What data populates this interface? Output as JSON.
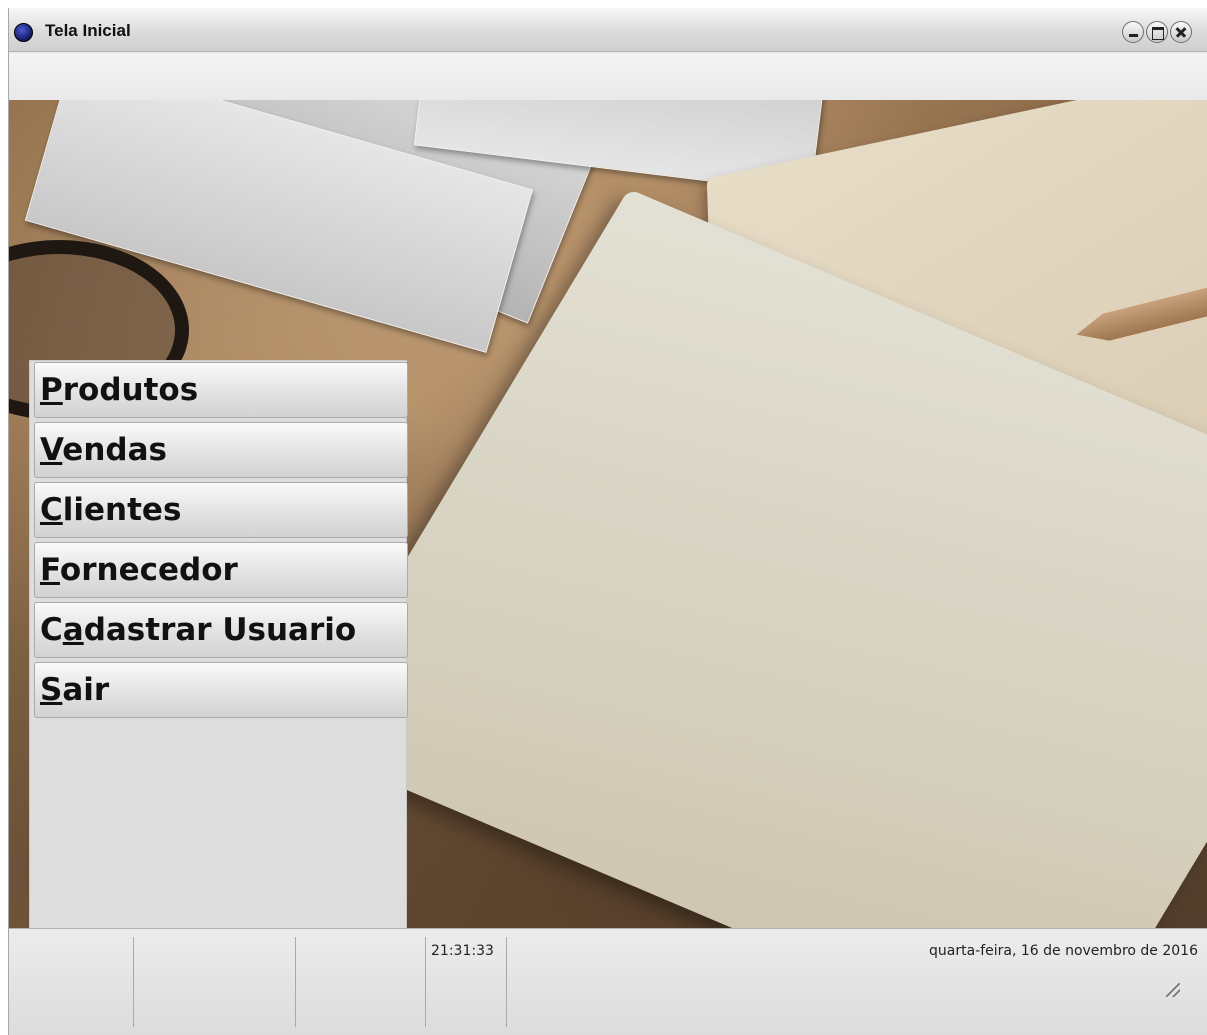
{
  "window": {
    "title": "Tela Inicial",
    "controls": {
      "minimize_icon": "minimize-icon",
      "maximize_icon": "maximize-icon",
      "close_icon": "close-icon"
    }
  },
  "menu": {
    "items": [
      {
        "mnemonic_before": "",
        "mnemonic": "P",
        "rest": "rodutos"
      },
      {
        "mnemonic_before": "",
        "mnemonic": "V",
        "rest": "endas"
      },
      {
        "mnemonic_before": "",
        "mnemonic": "C",
        "rest": "lientes"
      },
      {
        "mnemonic_before": "",
        "mnemonic": "F",
        "rest": "ornecedor"
      },
      {
        "mnemonic_before": "C",
        "mnemonic": "a",
        "rest": "dastrar Usuario"
      },
      {
        "mnemonic_before": "",
        "mnemonic": "S",
        "rest": "air"
      }
    ]
  },
  "statusbar": {
    "time": "21:31:33",
    "date": "quarta-feira, 16 de novembro de 2016"
  },
  "colors": {
    "chrome": "#e4e4e4",
    "button_top": "#fafafa",
    "button_bottom": "#d2d2d2"
  }
}
